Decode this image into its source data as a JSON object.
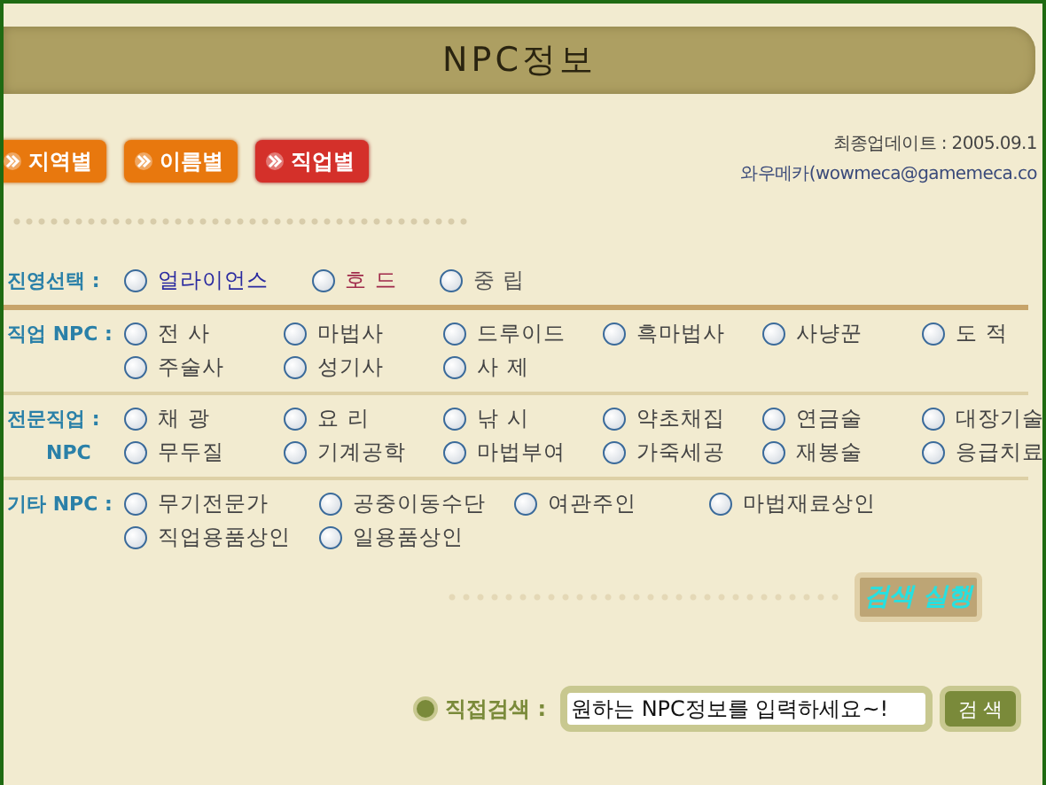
{
  "title": "NPC정보",
  "view_tabs": [
    {
      "label": "지역별",
      "selected": false
    },
    {
      "label": "이름별",
      "selected": false
    },
    {
      "label": "직업별",
      "selected": true
    }
  ],
  "update_info": {
    "date_line": "최종업데이트 : 2005.09.1",
    "author_line": "와우메카(wowmeca@gamemeca.co"
  },
  "sections": [
    {
      "kind": "faction",
      "label": "진영선택 :",
      "items": [
        {
          "label": "얼라이언스",
          "selected": false,
          "color": "#2a2aa0"
        },
        {
          "label": "호 드",
          "selected": false,
          "color": "#a02a4a"
        },
        {
          "label": "중 립",
          "selected": false,
          "color": "#555555"
        }
      ]
    },
    {
      "kind": "grid",
      "label": "직업 NPC :",
      "items": [
        {
          "label": "전 사",
          "selected": false
        },
        {
          "label": "마법사",
          "selected": false
        },
        {
          "label": "드루이드",
          "selected": false
        },
        {
          "label": "흑마법사",
          "selected": false
        },
        {
          "label": "사냥꾼",
          "selected": false
        },
        {
          "label": "도 적",
          "selected": false
        },
        {
          "label": "주술사",
          "selected": false
        },
        {
          "label": "성기사",
          "selected": false
        },
        {
          "label": "사 제",
          "selected": false
        }
      ]
    },
    {
      "kind": "grid",
      "label": "전문직업 :",
      "sublabel": "NPC",
      "items": [
        {
          "label": "채 광",
          "selected": false
        },
        {
          "label": "요 리",
          "selected": false
        },
        {
          "label": "낚 시",
          "selected": false
        },
        {
          "label": "약초채집",
          "selected": false
        },
        {
          "label": "연금술",
          "selected": false
        },
        {
          "label": "대장기술",
          "selected": false
        },
        {
          "label": "무두질",
          "selected": false
        },
        {
          "label": "기계공학",
          "selected": false
        },
        {
          "label": "마법부여",
          "selected": false
        },
        {
          "label": "가죽세공",
          "selected": false
        },
        {
          "label": "재봉술",
          "selected": false
        },
        {
          "label": "응급치료",
          "selected": false
        }
      ]
    },
    {
      "kind": "wide",
      "label": "기타 NPC :",
      "items": [
        {
          "label": "무기전문가",
          "selected": false
        },
        {
          "label": "공중이동수단",
          "selected": false
        },
        {
          "label": "여관주인",
          "selected": false
        },
        {
          "label": "마법재료상인",
          "selected": false
        },
        {
          "label": "직업용품상인",
          "selected": false
        },
        {
          "label": "일용품상인",
          "selected": false
        }
      ]
    }
  ],
  "run_button": "검색 실행",
  "direct_search": {
    "label": "직접검색 :",
    "value": "원하는 NPC정보를 입력하세요~!",
    "button": "검 색"
  }
}
